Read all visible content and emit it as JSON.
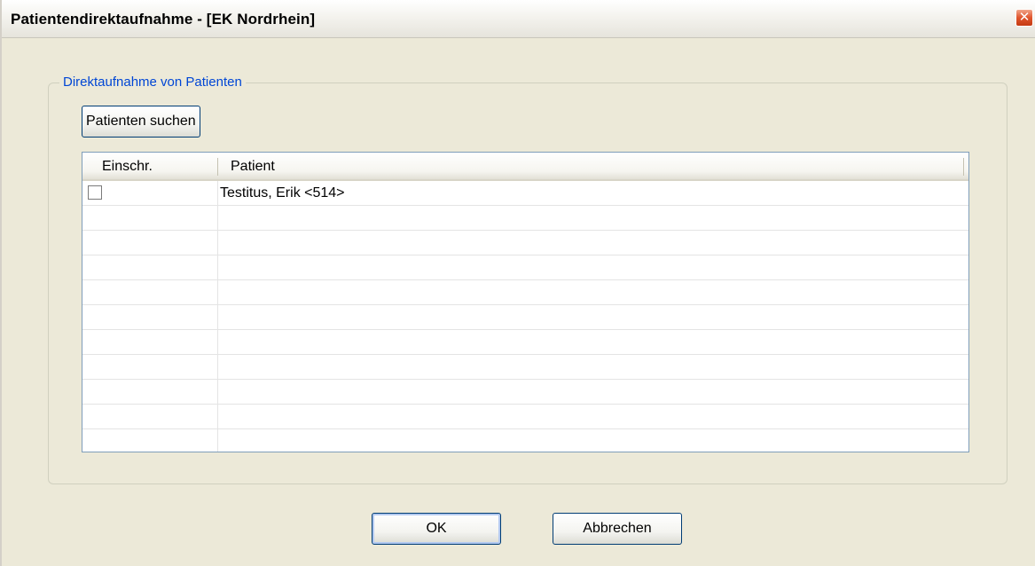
{
  "window": {
    "title": "Patientendirektaufnahme - [EK Nordrhein]",
    "close_glyph": "✕"
  },
  "group": {
    "legend": "Direktaufnahme von Patienten",
    "search_button_label": "Patienten suchen"
  },
  "grid": {
    "columns": [
      "Einschr.",
      "Patient"
    ],
    "rows": [
      {
        "restricted": false,
        "patient": "Testitus,  Erik <514>"
      },
      {
        "restricted": null,
        "patient": ""
      },
      {
        "restricted": null,
        "patient": ""
      },
      {
        "restricted": null,
        "patient": ""
      },
      {
        "restricted": null,
        "patient": ""
      },
      {
        "restricted": null,
        "patient": ""
      },
      {
        "restricted": null,
        "patient": ""
      },
      {
        "restricted": null,
        "patient": ""
      },
      {
        "restricted": null,
        "patient": ""
      },
      {
        "restricted": null,
        "patient": ""
      },
      {
        "restricted": null,
        "patient": ""
      }
    ]
  },
  "buttons": {
    "ok_label": "OK",
    "cancel_label": "Abbrechen"
  },
  "colors": {
    "accent": "#0046d5",
    "close": "#e0552c",
    "background": "#ece9d8"
  }
}
